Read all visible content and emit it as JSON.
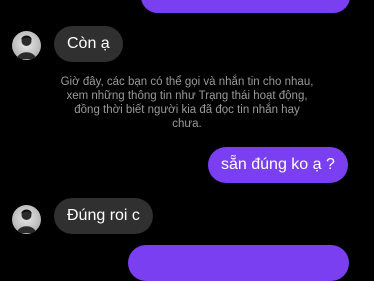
{
  "chat": {
    "colors": {
      "background": "#000000",
      "outgoing_bubble": "#7b3ff2",
      "incoming_bubble": "#303030",
      "notice_text": "#9a9a9a"
    },
    "messages": [
      {
        "direction": "incoming",
        "text": "Còn ạ"
      },
      {
        "direction": "outgoing",
        "text": "sẵn đúng ko ạ ?"
      },
      {
        "direction": "incoming",
        "text": "Đúng roi c"
      }
    ],
    "system_notice": "Giờ đây, các bạn có thể gọi và nhắn tin cho nhau, xem những thông tin như Trạng thái hoạt động, đồng thời biết người kia đã đọc tin nhắn hay chưa.",
    "avatar_icon": "user-avatar-icon"
  }
}
